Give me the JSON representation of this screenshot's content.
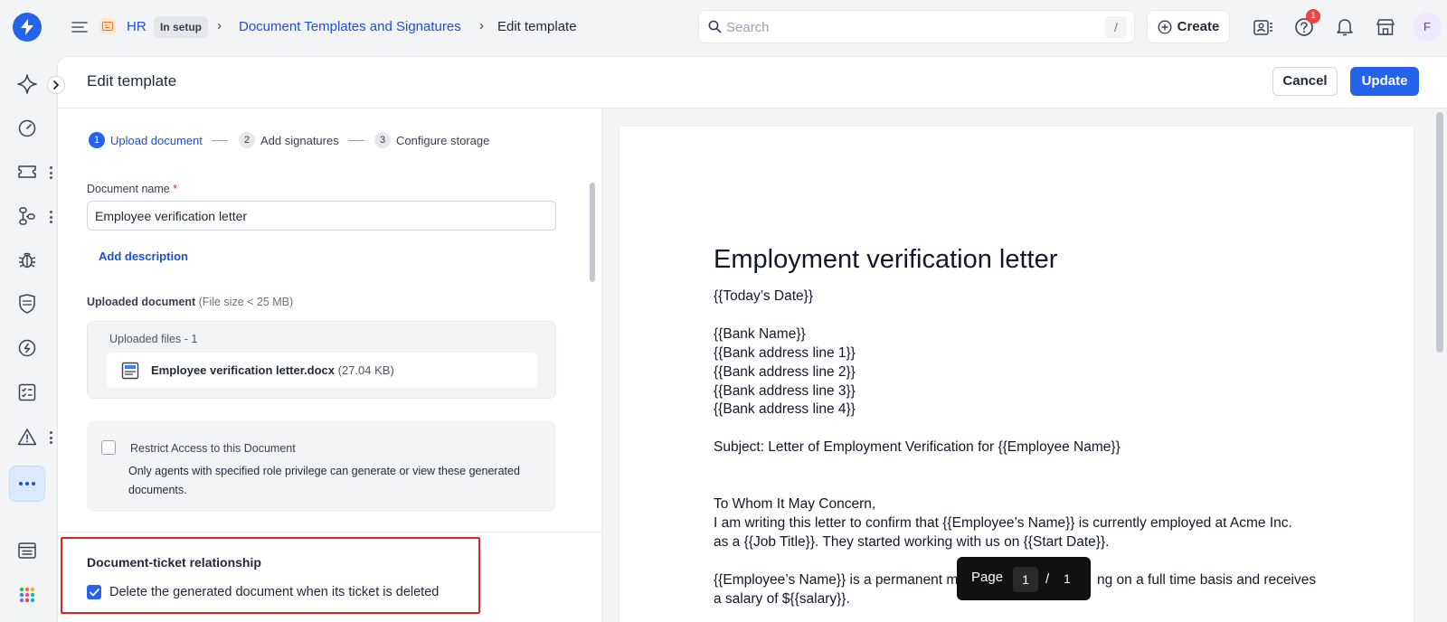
{
  "header": {
    "module": "HR",
    "module_status": "In setup",
    "breadcrumb_parent": "Document Templates and Signatures",
    "breadcrumb_current": "Edit template",
    "search_placeholder": "Search",
    "search_shortcut": "/",
    "create_label": "Create",
    "help_badge_count": "1",
    "avatar_initial": "F"
  },
  "panel": {
    "title": "Edit template",
    "cancel_label": "Cancel",
    "update_label": "Update"
  },
  "steps": [
    {
      "num": "1",
      "label": "Upload document",
      "active": true
    },
    {
      "num": "2",
      "label": "Add signatures",
      "active": false
    },
    {
      "num": "3",
      "label": "Configure storage",
      "active": false
    }
  ],
  "form": {
    "doc_name_label": "Document name",
    "required_mark": "*",
    "doc_name_value": "Employee verification letter",
    "add_description": "Add description",
    "uploaded_label": "Uploaded document",
    "uploaded_hint": "(File size < 25 MB)",
    "uploaded_files_title": "Uploaded files - 1",
    "file_name": "Employee verification letter.docx",
    "file_size": "(27.04 KB)",
    "restrict_title": "Restrict Access to this Document",
    "restrict_desc": "Only agents with specified role privilege can generate or view these generated documents.",
    "relation_title": "Document-ticket relationship",
    "relation_label": "Delete the generated document when its ticket is deleted"
  },
  "preview": {
    "heading": "Employment verification letter",
    "lines": [
      "{{Today’s Date}}",
      "{{Bank Name}}",
      "{{Bank address line 1}}",
      "{{Bank address line 2}}",
      "{{Bank address line 3}}",
      "{{Bank address line 4}}",
      "Subject: Letter of Employment Verification for {{Employee Name}}",
      "To Whom It May Concern,",
      "I am writing this letter to confirm that {{Employee’s Name}} is currently employed at Acme Inc.",
      "as a {{Job Title}}. They started working with us on {{Start Date}}.",
      "{{Employee’s Name}} is a permanent m",
      "ng on a full time basis and receives",
      "a salary of ${{salary}}."
    ],
    "pager_label": "Page",
    "pager_current": "1",
    "pager_sep": "/",
    "pager_total": "1"
  },
  "rail": {
    "icons": [
      "spark-icon",
      "gauge-icon",
      "ticket-icon",
      "workflow-icon",
      "bug-icon",
      "shield-icon",
      "money-icon",
      "checklist-icon",
      "warning-icon",
      "more-icon",
      "catalog-icon",
      "apps-grid-icon"
    ]
  },
  "colors": {
    "primary": "#2563eb",
    "link": "#1d4ed8",
    "danger": "#dc2626"
  }
}
